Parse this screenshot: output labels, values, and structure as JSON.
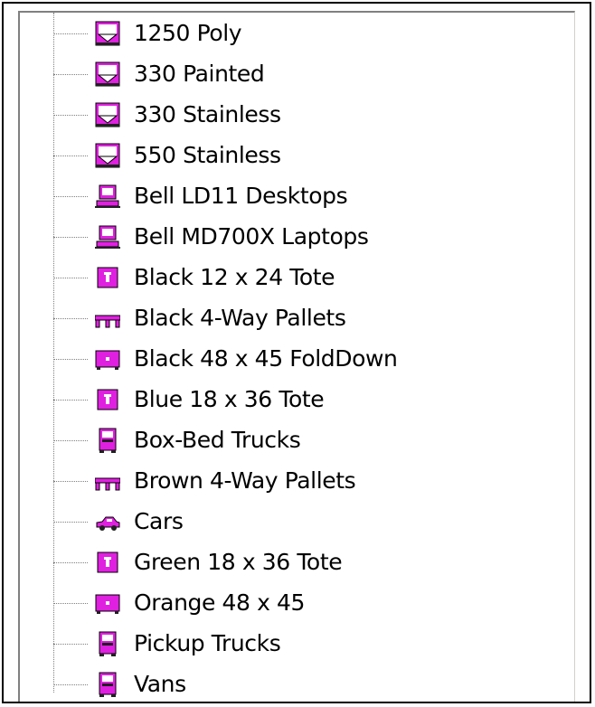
{
  "tree": {
    "accent_color": "#e020e0",
    "items": [
      {
        "label": "1250 Poly",
        "icon": "tank-icon"
      },
      {
        "label": "330 Painted",
        "icon": "tank-icon"
      },
      {
        "label": "330 Stainless",
        "icon": "tank-icon"
      },
      {
        "label": "550 Stainless",
        "icon": "tank-icon"
      },
      {
        "label": "Bell LD11 Desktops",
        "icon": "computer-icon"
      },
      {
        "label": "Bell MD700X Laptops",
        "icon": "computer-icon"
      },
      {
        "label": "Black 12 x 24 Tote",
        "icon": "tote-icon"
      },
      {
        "label": "Black 4-Way Pallets",
        "icon": "pallet-icon"
      },
      {
        "label": "Black 48 x 45 FoldDown",
        "icon": "bin-icon"
      },
      {
        "label": "Blue 18 x 36 Tote",
        "icon": "tote-icon"
      },
      {
        "label": "Box-Bed Trucks",
        "icon": "truck-icon"
      },
      {
        "label": "Brown 4-Way Pallets",
        "icon": "pallet-icon"
      },
      {
        "label": "Cars",
        "icon": "car-icon"
      },
      {
        "label": "Green 18 x 36 Tote",
        "icon": "tote-icon"
      },
      {
        "label": "Orange 48 x 45",
        "icon": "bin-icon"
      },
      {
        "label": "Pickup Trucks",
        "icon": "truck-icon"
      },
      {
        "label": "Vans",
        "icon": "truck-icon"
      }
    ]
  }
}
